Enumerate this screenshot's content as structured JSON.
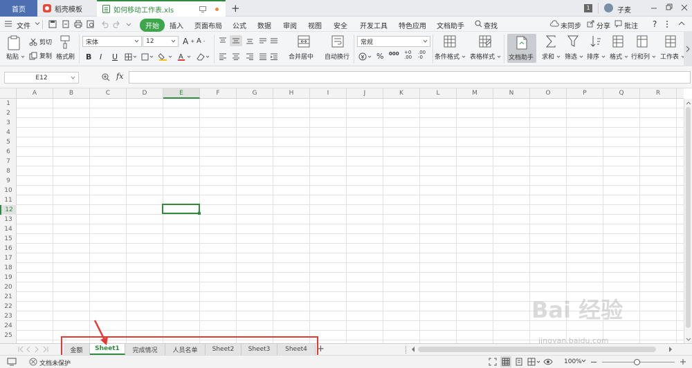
{
  "titlebar": {
    "home_tab": "首页",
    "templates_tab": "稻壳模板",
    "file_tab": "如何移动工作表.xls",
    "new_tab": "+",
    "badge": "1",
    "user": "子麦"
  },
  "menubar": {
    "file": "文件",
    "items": [
      "开始",
      "插入",
      "页面布局",
      "公式",
      "数据",
      "审阅",
      "视图",
      "安全",
      "开发工具",
      "特色应用",
      "文档助手"
    ],
    "search": "查找",
    "sync": "未同步",
    "share": "分享",
    "comment": "批注",
    "help": "?"
  },
  "ribbon": {
    "paste": "粘贴",
    "cut": "剪切",
    "copy": "复制",
    "format_painter": "格式刷",
    "font_name": "宋体",
    "font_size": "12",
    "merge_center": "合并居中",
    "wrap_text": "自动换行",
    "number_format": "常规",
    "conditional_format": "条件格式",
    "table_style": "表格样式",
    "doc_assistant": "文档助手",
    "sum": "求和",
    "filter": "筛选",
    "sort": "排序",
    "format": "格式",
    "row_col": "行和列",
    "worksheet": "工作表"
  },
  "formula_bar": {
    "cell_ref": "E12",
    "fx": "fx",
    "value": ""
  },
  "columns": [
    "A",
    "B",
    "C",
    "D",
    "E",
    "F",
    "G",
    "H",
    "I",
    "J",
    "K",
    "L",
    "M",
    "N",
    "O",
    "P",
    "Q",
    "R"
  ],
  "rows": [
    "1",
    "2",
    "3",
    "4",
    "5",
    "6",
    "7",
    "8",
    "9",
    "10",
    "11",
    "12",
    "13",
    "14",
    "15",
    "16",
    "17",
    "18",
    "19",
    "20",
    "21",
    "22",
    "23",
    "24",
    "25"
  ],
  "selected_cell": {
    "col": "E",
    "row": "12"
  },
  "sheet_tabs": [
    {
      "label": "金额",
      "active": false
    },
    {
      "label": "Sheet1",
      "active": true
    },
    {
      "label": "完成情况",
      "active": false
    },
    {
      "label": "人员名单",
      "active": false
    },
    {
      "label": "Sheet2",
      "active": false
    },
    {
      "label": "Sheet3",
      "active": false
    },
    {
      "label": "Sheet4",
      "active": false
    }
  ],
  "add_sheet": "+",
  "statusbar": {
    "protect": "文档未保护",
    "zoom": "100%"
  },
  "watermark": {
    "brand": "Bai 经验",
    "url": "jingyan.baidu.com"
  },
  "colors": {
    "accent": "#3da54a",
    "home_tab": "#4b6fb0",
    "highlight": "#e53935"
  }
}
